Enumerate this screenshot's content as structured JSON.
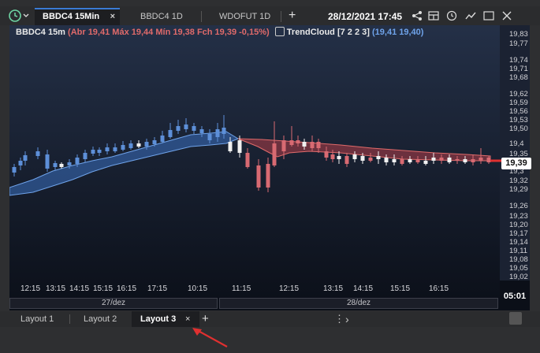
{
  "top_tabs": [
    {
      "label": "BBDC4 15Min",
      "active": true
    },
    {
      "label": "BBDC4 1D",
      "active": false
    },
    {
      "label": "WDOFUT 1D",
      "active": false
    }
  ],
  "close_glyph": "×",
  "add_glyph": "+",
  "datetime": "28/12/2021 17:45",
  "info": {
    "symbol": "BBDC4 15m",
    "open": "(Abr 19,41",
    "high": "Máx 19,44",
    "low": "Mín 19,38",
    "close": "Fch 19,39",
    "change": "-0,15%)",
    "indicator": "TrendCloud [7 2 2 3]",
    "indicator_values": "(19,41 19,40)"
  },
  "y_ticks": [
    "19,83",
    "19,77",
    "19,74",
    "19,71",
    "19,68",
    "19,62",
    "19,59",
    "19,56",
    "19,53",
    "19,50",
    "19,4",
    "19,35",
    "19,3",
    "19,32",
    "19,29",
    "19,26",
    "19,23",
    "19,20",
    "19,17",
    "19,14",
    "19,11",
    "19,08",
    "19,05",
    "19,02"
  ],
  "current_price": "19,39",
  "x_ticks": [
    "12:15",
    "13:15",
    "14:15",
    "15:15",
    "16:15",
    "17:15",
    "10:15",
    "11:15",
    "12:15",
    "13:15",
    "14:15",
    "15:15",
    "16:15"
  ],
  "dates": [
    "27/dez",
    "28/dez"
  ],
  "countdown": "05:01",
  "layout_tabs": [
    {
      "label": "Layout 1",
      "active": false
    },
    {
      "label": "Layout 2",
      "active": false
    },
    {
      "label": "Layout 3",
      "active": true
    }
  ],
  "more_glyph": "⋮",
  "next_glyph": "›",
  "colors": {
    "up": "#6fa3ea",
    "down": "#e06a6a",
    "bg_top": "#243047",
    "bg_bottom": "#0b0f18"
  }
}
